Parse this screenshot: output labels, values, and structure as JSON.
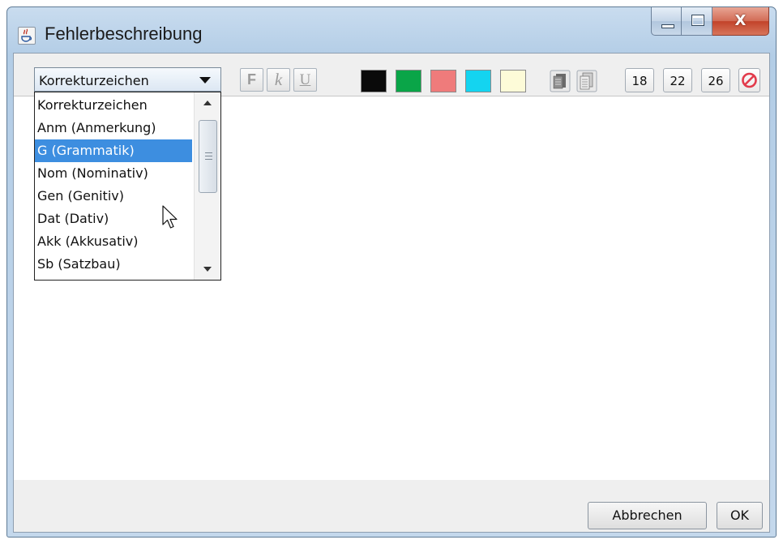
{
  "window": {
    "title": "Fehlerbeschreibung",
    "controls": {
      "minimize": "minimize",
      "maximize": "maximize",
      "close": "X"
    }
  },
  "toolbar": {
    "combo_value": "Korrekturzeichen",
    "format_buttons": {
      "bold": "F",
      "italic": "k",
      "underline": "U"
    },
    "colors": [
      "#0a0a0a",
      "#0aa548",
      "#ef7b7b",
      "#14d4f0",
      "#fdfbd8"
    ],
    "sizes": [
      "18",
      "22",
      "26"
    ]
  },
  "dropdown": {
    "items": [
      "Korrekturzeichen",
      "Anm (Anmerkung)",
      "G (Grammatik)",
      "Nom (Nominativ)",
      "Gen (Genitiv)",
      "Dat (Dativ)",
      "Akk (Akkusativ)",
      "Sb (Satzbau)"
    ],
    "selected_index": 2
  },
  "footer": {
    "cancel_label": "Abbrechen",
    "ok_label": "OK"
  }
}
